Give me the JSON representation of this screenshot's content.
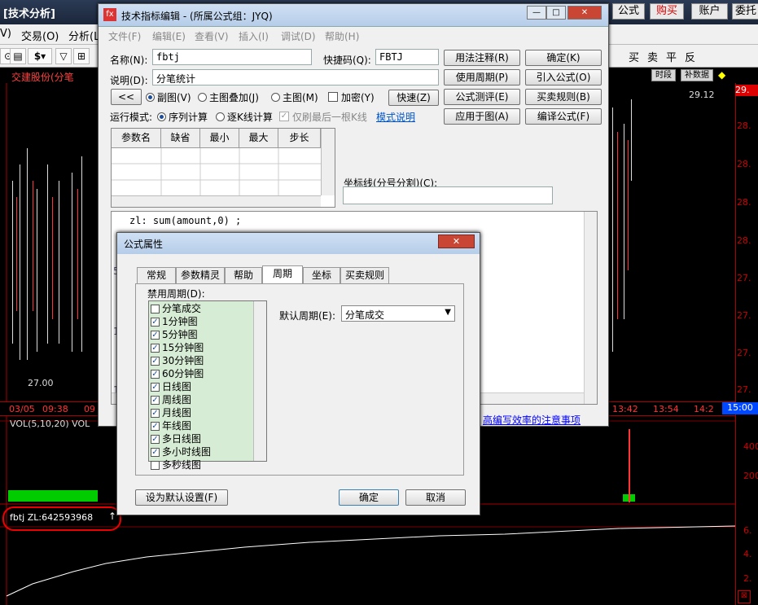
{
  "app": {
    "title": "[技术分析]",
    "top_buttons": [
      "公式",
      "购买",
      "账户",
      "委托"
    ],
    "menus": [
      "V)",
      "交易(O)",
      "分析(L"
    ],
    "trade_buttons": [
      "买",
      "卖",
      "平",
      "反"
    ],
    "stock_name": "交建股份(分笔",
    "tags": [
      "时段",
      "补数据"
    ],
    "last_price": "29.",
    "price_labels": [
      "28.",
      "28.",
      "28.",
      "28.",
      "27.",
      "27.",
      "27.",
      "27."
    ],
    "price_low": "27.00",
    "price_high": "29.12",
    "time_labels": [
      "03/05",
      "09:38",
      "09",
      "13:42",
      "13:54",
      "14:2"
    ],
    "time_end": "15:00",
    "vol_label": "VOL(5,10,20) VOL",
    "vol_axis": [
      "400",
      "200"
    ],
    "fbtj_label": "fbtj ZL:642593968",
    "fbtj_axis": [
      "6.",
      "4.",
      "2."
    ]
  },
  "dlg1": {
    "title": "技术指标编辑 - (所属公式组：JYQ)",
    "menus": [
      "文件(F)",
      "编辑(E)",
      "查看(V)",
      "插入(I)",
      "调试(D)",
      "帮助(H)"
    ],
    "name_label": "名称(N):",
    "name_value": "fbtj",
    "shortcut_label": "快捷码(Q):",
    "shortcut_value": "FBTJ",
    "desc_label": "说明(D):",
    "desc_value": "分笔统计",
    "collapse": "<<",
    "radio_sub": "副图(V)",
    "radio_overlay": "主图叠加(J)",
    "radio_main": "主图(M)",
    "chk_encrypt": "加密(Y)",
    "quick": "快速(Z)",
    "run_mode_label": "运行模式:",
    "run_seq": "序列计算",
    "run_bar": "逐K线计算",
    "run_last": "仅刷最后一根K线",
    "mode_link": "模式说明",
    "grid_headers": [
      "参数名",
      "缺省",
      "最小",
      "最大",
      "步长"
    ],
    "axis_line_label": "坐标线(分号分割)(C):",
    "right_buttons": [
      "用法注释(R)",
      "确定(K)",
      "使用周期(P)",
      "引入公式(O)",
      "公式测评(E)",
      "买卖规则(B)",
      "应用于图(A)",
      "编译公式(F)"
    ],
    "code": "zl: sum(amount,0) ;",
    "notice": "高编写效率的注意事项",
    "gutter": [
      "5",
      "10",
      "1"
    ]
  },
  "dlg2": {
    "title": "公式属性",
    "tabs": [
      "常规",
      "参数精灵",
      "帮助",
      "周期",
      "坐标",
      "买卖规则"
    ],
    "disable_label": "禁用周期(D):",
    "default_label": "默认周期(E):",
    "default_value": "分笔成交",
    "periods": [
      {
        "name": "分笔成交",
        "checked": false
      },
      {
        "name": "1分钟图",
        "checked": true
      },
      {
        "name": "5分钟图",
        "checked": true
      },
      {
        "name": "15分钟图",
        "checked": true
      },
      {
        "name": "30分钟图",
        "checked": true
      },
      {
        "name": "60分钟图",
        "checked": true
      },
      {
        "name": "日线图",
        "checked": true
      },
      {
        "name": "周线图",
        "checked": true
      },
      {
        "name": "月线图",
        "checked": true
      },
      {
        "name": "年线图",
        "checked": true
      },
      {
        "name": "多日线图",
        "checked": true
      },
      {
        "name": "多小时线图",
        "checked": true
      },
      {
        "name": "多秒线图",
        "checked": false
      }
    ],
    "set_default": "设为默认设置(F)",
    "ok": "确定",
    "cancel": "取消"
  }
}
